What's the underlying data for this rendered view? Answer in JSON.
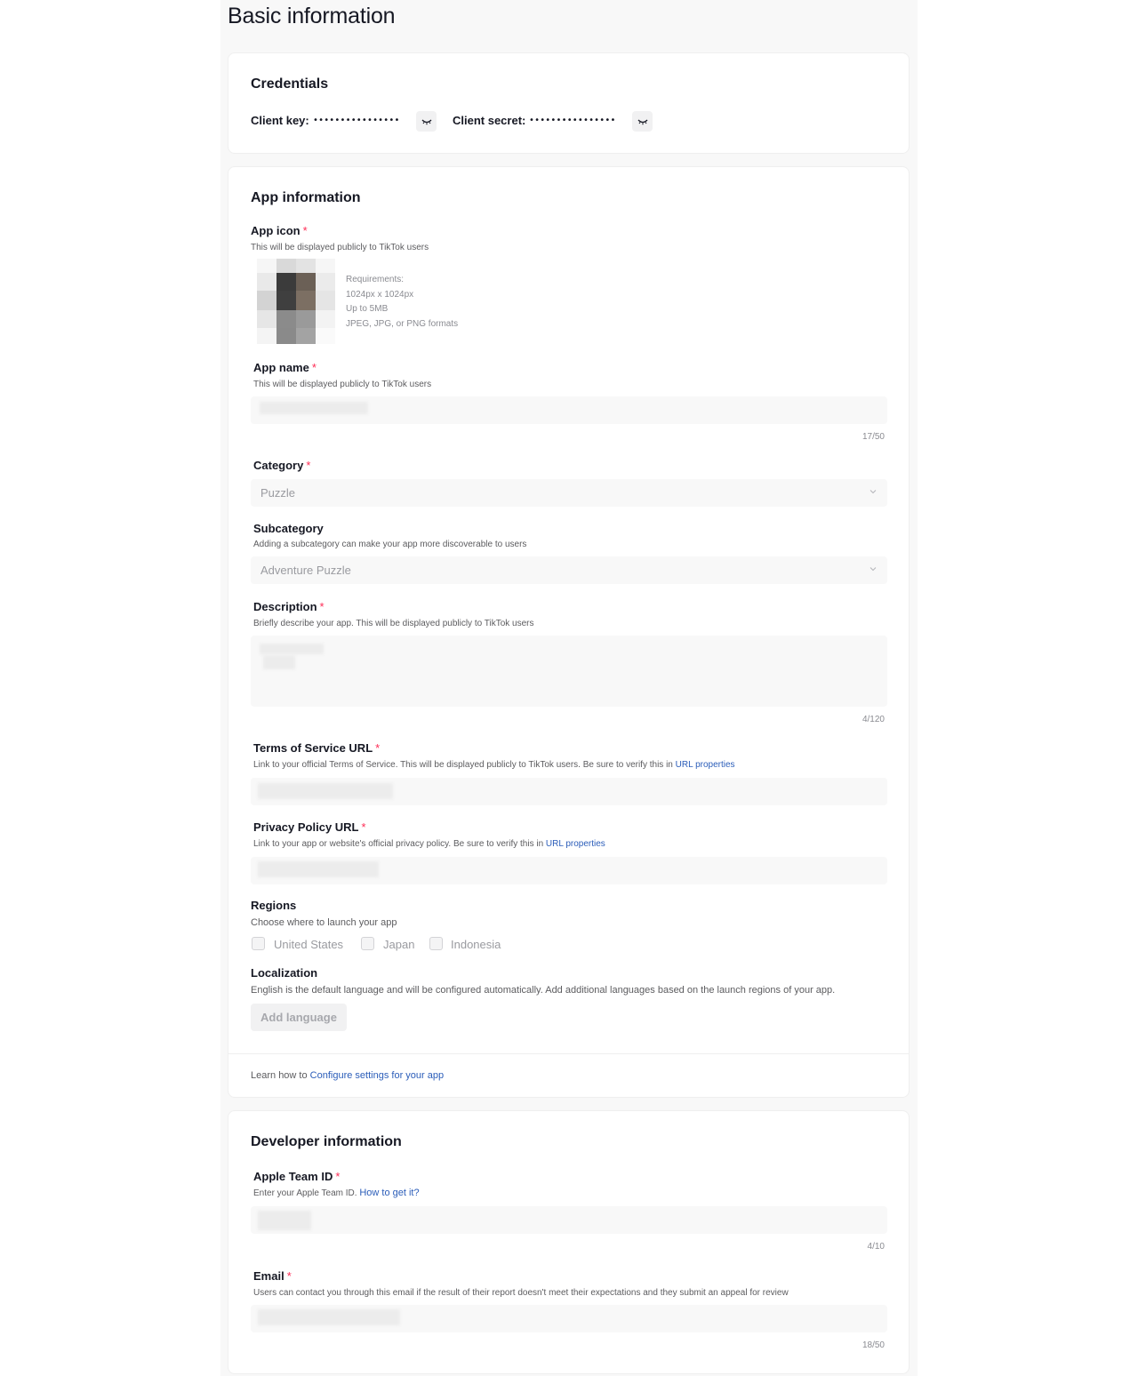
{
  "page": {
    "title": "Basic information"
  },
  "credentials": {
    "title": "Credentials",
    "client_key_label": "Client key:",
    "client_key_value": "••••••••••••••••",
    "client_secret_label": "Client secret:",
    "client_secret_value": "••••••••••••••••"
  },
  "app_info": {
    "title": "App information",
    "icon": {
      "label": "App icon",
      "hint": "This will be displayed publicly to TikTok users",
      "requirements": [
        "Requirements:",
        "1024px x 1024px",
        "Up to 5MB",
        "JPEG, JPG, or PNG formats"
      ]
    },
    "name": {
      "label": "App name",
      "hint": "This will be displayed publicly to TikTok users",
      "counter": "17/50"
    },
    "category": {
      "label": "Category",
      "value": "Puzzle"
    },
    "subcategory": {
      "label": "Subcategory",
      "hint": "Adding a subcategory can make your app more discoverable to users",
      "value": "Adventure Puzzle"
    },
    "description": {
      "label": "Description",
      "hint": "Briefly describe your app. This will be displayed publicly to TikTok users",
      "counter": "4/120"
    },
    "tos": {
      "label": "Terms of Service URL",
      "hint": "Link to your official Terms of Service. This will be displayed publicly to TikTok users. Be sure to verify this in",
      "link": "URL properties"
    },
    "privacy": {
      "label": "Privacy Policy URL",
      "hint": "Link to your app or website's official privacy policy. Be sure to verify this in",
      "link": "URL properties"
    },
    "regions": {
      "label": "Regions",
      "hint": "Choose where to launch your app",
      "options": [
        "United States",
        "Japan",
        "Indonesia"
      ]
    },
    "localization": {
      "label": "Localization",
      "hint": "English is the default language and will be configured automatically. Add additional languages based on the launch regions of your app.",
      "button": "Add language"
    },
    "footer": {
      "prefix": "Learn how to",
      "link": "Configure settings for your app"
    }
  },
  "developer_info": {
    "title": "Developer information",
    "team_id": {
      "label": "Apple Team ID",
      "hint": "Enter your Apple Team ID.",
      "link": "How to get it?",
      "counter": "4/10"
    },
    "email": {
      "label": "Email",
      "hint": "Users can contact you through this email if the result of their report doesn't meet their expectations and they submit an appeal for review",
      "counter": "18/50"
    }
  },
  "colors": {
    "required": "#fe2c55",
    "link": "#2b5db9",
    "page_bg": "#f8f8f8",
    "card_bg": "#ffffff"
  },
  "icons": {
    "reveal": "closed-eye-icon",
    "dropdown": "chevron-down-icon"
  }
}
